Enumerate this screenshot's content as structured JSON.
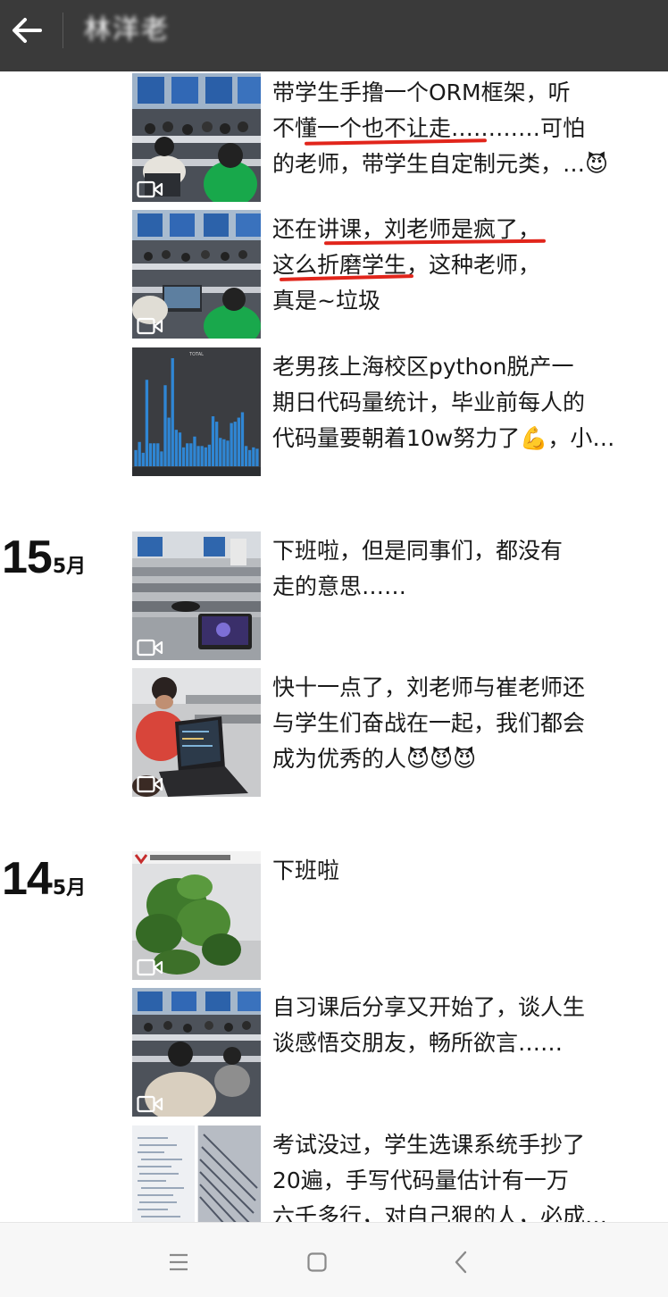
{
  "header": {
    "back_label": "←",
    "title": "林洋老"
  },
  "groups": [
    {
      "day": "",
      "month": "",
      "posts": [
        {
          "lines": [
            "带学生手撸一个ORM框架，听",
            "不懂一个也不让走…………可怕",
            "的老师，带学生自定制元类，…😈"
          ],
          "thumb": "classroom-photo",
          "video": true
        },
        {
          "lines": [
            "还在讲课，刘老师是疯了，",
            "这么折磨学生，这种老师，",
            "真是~垃圾"
          ],
          "thumb": "classroom-photo",
          "video": true
        },
        {
          "lines": [
            "老男孩上海校区python脱产一",
            "期日代码量统计，毕业前每人的",
            "代码量要朝着10w努力了💪，小…"
          ],
          "thumb": "code-stats-chart",
          "video": false
        }
      ]
    },
    {
      "day": "15",
      "month": "5月",
      "posts": [
        {
          "lines": [
            "下班啦，但是同事们，都没有",
            "走的意思……"
          ],
          "thumb": "classroom-photo",
          "video": true
        },
        {
          "lines": [
            "快十一点了，刘老师与崔老师还",
            "与学生们奋战在一起，我们都会",
            "成为优秀的人😈😈😈"
          ],
          "thumb": "student-laptop-photo",
          "video": true
        }
      ]
    },
    {
      "day": "14",
      "month": "5月",
      "posts": [
        {
          "lines": [
            "下班啦"
          ],
          "thumb": "office-plant-photo",
          "video": true
        },
        {
          "lines": [
            "自习课后分享又开始了，谈人生",
            "谈感悟交朋友，畅所欲言……"
          ],
          "thumb": "classroom-photo",
          "video": true
        },
        {
          "lines": [
            "考试没过，学生选课系统手抄了",
            "20遍，手写代码量估计有一万",
            "六千多行，对自己狠的人，必成…"
          ],
          "thumb": "handwritten-code-photo",
          "video": false
        }
      ]
    }
  ],
  "chart_thumb": {
    "title": "TOTAL",
    "values": [
      12,
      18,
      10,
      64,
      17,
      17,
      17,
      11,
      60,
      36,
      80,
      27,
      25,
      14,
      17,
      17,
      22,
      15,
      15,
      14,
      16,
      37,
      33,
      21,
      20,
      19,
      32,
      33,
      36,
      40,
      15,
      12,
      14,
      13
    ]
  },
  "navbar": {
    "menu_icon": "menu-icon",
    "home_icon": "home-icon",
    "back_icon": "back-icon"
  }
}
